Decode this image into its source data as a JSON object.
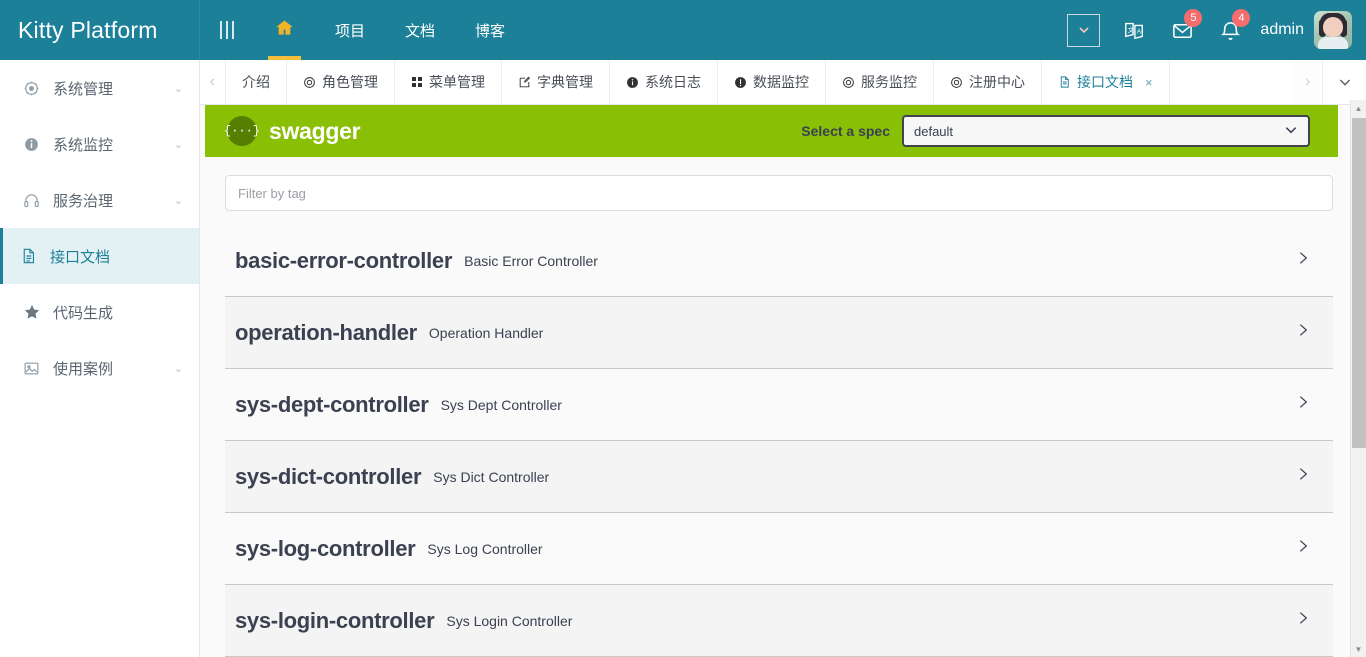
{
  "header": {
    "brand": "Kitty Platform",
    "menu_toggle_icon": "hamburger-icon",
    "nav": [
      {
        "label": "",
        "icon": "home-icon",
        "glyph": "⌂",
        "active": true
      },
      {
        "label": "项目",
        "icon": "",
        "glyph": "",
        "active": false
      },
      {
        "label": "文档",
        "icon": "",
        "glyph": "",
        "active": false
      },
      {
        "label": "博客",
        "icon": "",
        "glyph": "",
        "active": false
      }
    ],
    "fullscreen_icon": "chevron-down-box-icon",
    "translate_icon": "translate-icon",
    "message_icon": "mail-icon",
    "message_badge": "5",
    "notification_icon": "bell-icon",
    "notification_badge": "4",
    "username": "admin",
    "avatar_alt": "user-avatar"
  },
  "sidebar": {
    "items": [
      {
        "label": "系统管理",
        "icon": "gear-icon",
        "glyph": "◎",
        "arrow": "⌄",
        "active": false
      },
      {
        "label": "系统监控",
        "icon": "info-icon",
        "glyph": "ℹ",
        "arrow": "⌄",
        "active": false
      },
      {
        "label": "服务治理",
        "icon": "headset-icon",
        "glyph": "☎",
        "arrow": "⌄",
        "active": false
      },
      {
        "label": "接口文档",
        "icon": "document-icon",
        "glyph": "☷",
        "arrow": "",
        "active": true
      },
      {
        "label": "代码生成",
        "icon": "star-icon",
        "glyph": "★",
        "arrow": "",
        "active": false
      },
      {
        "label": "使用案例",
        "icon": "image-icon",
        "glyph": "⛰",
        "arrow": "⌄",
        "active": false
      }
    ]
  },
  "tabbar": {
    "scroll_left_icon": "chevron-left-icon",
    "scroll_right_icon": "chevron-right-icon",
    "dropdown_icon": "chevron-down-icon",
    "tabs": [
      {
        "label": "介绍",
        "glyph": "",
        "active": false,
        "closable": false
      },
      {
        "label": "角色管理",
        "glyph": "◎",
        "active": false,
        "closable": false
      },
      {
        "label": "菜单管理",
        "glyph": "☷",
        "active": false,
        "closable": false
      },
      {
        "label": "字典管理",
        "glyph": "✎",
        "active": false,
        "closable": false
      },
      {
        "label": "系统日志",
        "glyph": "ℹ",
        "active": false,
        "closable": false
      },
      {
        "label": "数据监控",
        "glyph": "❗",
        "active": false,
        "closable": false
      },
      {
        "label": "服务监控",
        "glyph": "◎",
        "active": false,
        "closable": false
      },
      {
        "label": "注册中心",
        "glyph": "◎",
        "active": false,
        "closable": false
      },
      {
        "label": "接口文档",
        "glyph": "☷",
        "active": true,
        "closable": true
      }
    ],
    "close_glyph": "×"
  },
  "swagger": {
    "logo_glyph": "{···}",
    "wordmark": "swagger",
    "spec_label": "Select a spec",
    "spec_value": "default",
    "spec_caret": "⌄",
    "filter_placeholder": "Filter by tag",
    "filter_value": "",
    "expand_caret": "›",
    "tags": [
      {
        "name": "basic-error-controller",
        "description": "Basic Error Controller"
      },
      {
        "name": "operation-handler",
        "description": "Operation Handler"
      },
      {
        "name": "sys-dept-controller",
        "description": "Sys Dept Controller"
      },
      {
        "name": "sys-dict-controller",
        "description": "Sys Dict Controller"
      },
      {
        "name": "sys-log-controller",
        "description": "Sys Log Controller"
      },
      {
        "name": "sys-login-controller",
        "description": "Sys Login Controller"
      }
    ]
  },
  "scrollbar": {
    "up_glyph": "▲",
    "down_glyph": "▼"
  },
  "colors": {
    "header_teal": "#1d8099",
    "swagger_green": "#89bf04",
    "accent_gold": "#f0b429",
    "badge_red": "#f56c6c",
    "tag_text": "#3b4151"
  }
}
